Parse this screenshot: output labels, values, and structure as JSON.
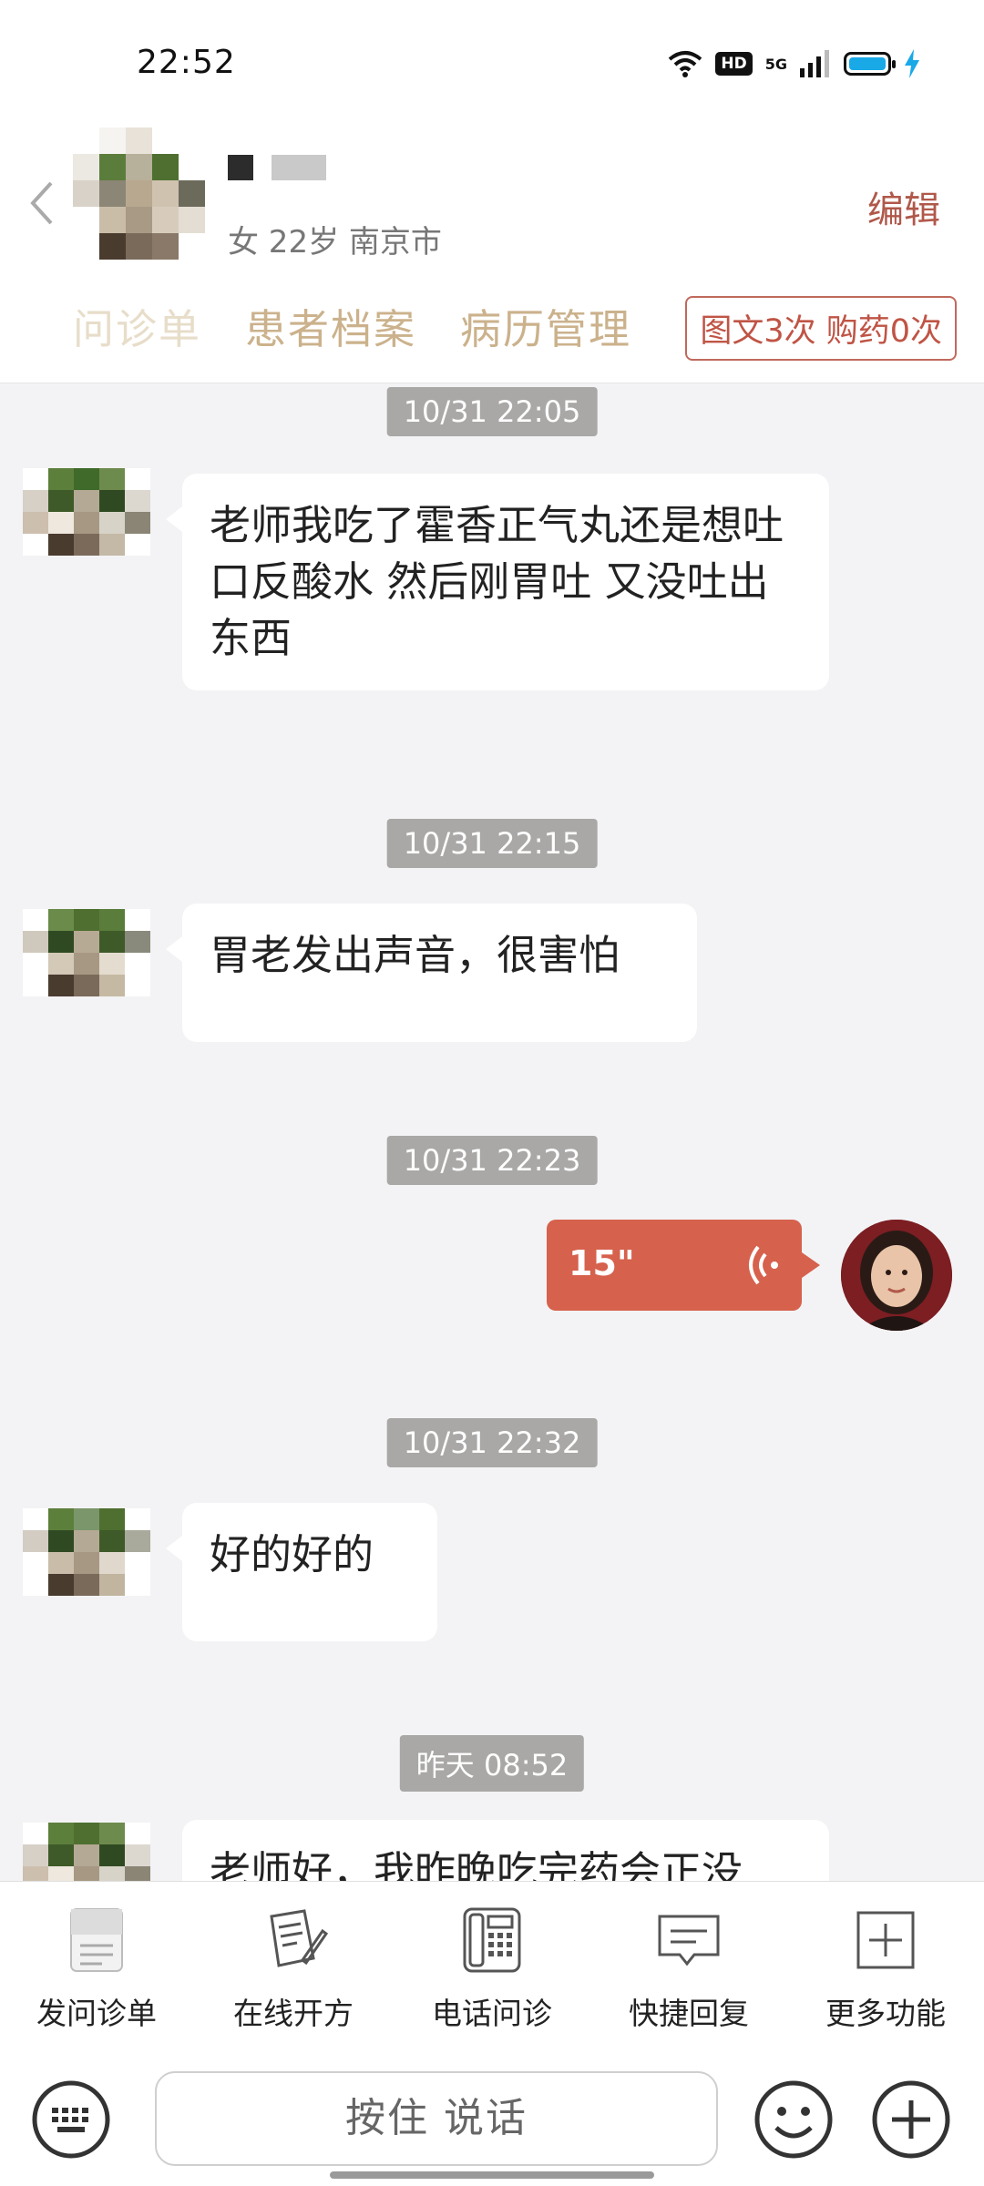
{
  "status_bar": {
    "time": "22:52",
    "hd": "HD",
    "network": "5G"
  },
  "header": {
    "patient_info": "女 22岁  南京市",
    "edit": "编辑",
    "tabs": [
      "问诊单",
      "患者档案",
      "病历管理"
    ],
    "quota_badge": "图文3次 购药0次"
  },
  "chat": {
    "messages": [
      {
        "time": "10/31 22:05",
        "sender": "patient",
        "text": "老师我吃了霍香正气丸还是想吐 口反酸水 然后刚胃吐 又没吐出东西"
      },
      {
        "time": "10/31 22:15",
        "sender": "patient",
        "text": "胃老发出声音，很害怕"
      },
      {
        "time": "10/31 22:23",
        "sender": "doctor",
        "voice_duration": "15\""
      },
      {
        "time": "10/31 22:32",
        "sender": "patient",
        "text": "好的好的"
      },
      {
        "time": "昨天 08:52",
        "sender": "patient",
        "text": "老师好，我昨晚吃完药会正没"
      }
    ]
  },
  "toolbar": {
    "items": [
      "发问诊单",
      "在线开方",
      "电话问诊",
      "快捷回复",
      "更多功能"
    ]
  },
  "input": {
    "hold_to_talk": "按住 说话"
  },
  "colors": {
    "accent": "#b0584a",
    "voice_bubble": "#d6614d",
    "tab_text": "#cbb28c",
    "timestamp_bg": "#a9a8a6"
  },
  "icons": [
    "wifi-icon",
    "signal-icon",
    "battery-icon",
    "back-icon",
    "voice-wave-icon",
    "form-icon",
    "prescription-icon",
    "phone-icon",
    "quick-reply-icon",
    "more-icon",
    "keyboard-icon",
    "emoji-icon",
    "plus-icon"
  ]
}
